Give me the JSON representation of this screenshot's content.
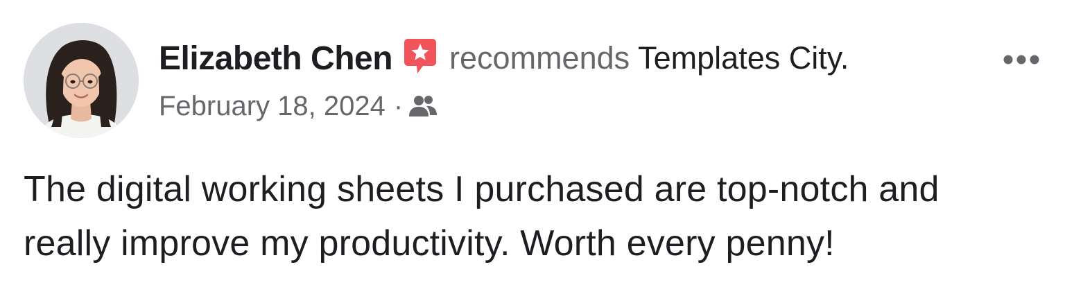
{
  "post": {
    "author_name": "Elizabeth Chen",
    "action": "recommends",
    "page_name": "Templates City.",
    "date": "February 18, 2024",
    "separator": "·",
    "body": "The digital working sheets I purchased are top-notch and really improve my productivity. Worth every penny!"
  },
  "icons": {
    "recommend": "recommend-star-icon",
    "audience": "friends-audience-icon",
    "more": "more-options-icon"
  },
  "colors": {
    "recommend_red": "#f2545b",
    "secondary_text": "#65676b",
    "primary_text": "#1c1e21"
  }
}
